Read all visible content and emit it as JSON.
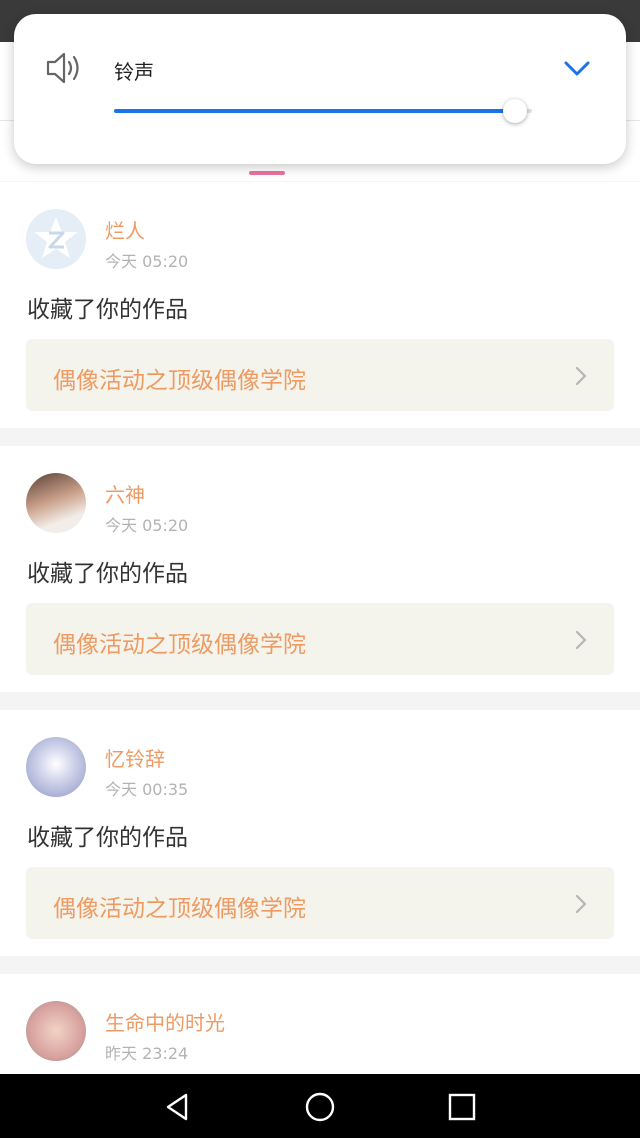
{
  "volume": {
    "label": "铃声",
    "level": 0.96,
    "icons": {
      "speaker": "speaker-icon",
      "expand": "chevron-down-icon"
    },
    "accent_color": "#1a73e8"
  },
  "notifications": [
    {
      "user": "烂人",
      "time": "今天 05:20",
      "action": "收藏了你的作品",
      "work": "偶像活动之顶级偶像学院"
    },
    {
      "user": "六神",
      "time": "今天 05:20",
      "action": "收藏了你的作品",
      "work": "偶像活动之顶级偶像学院"
    },
    {
      "user": "忆铃辞",
      "time": "今天 00:35",
      "action": "收藏了你的作品",
      "work": "偶像活动之顶级偶像学院"
    },
    {
      "user": "生命中的时光",
      "time": "昨天 23:24"
    }
  ],
  "colors": {
    "name_accent": "#ee9b63",
    "tab_indicator": "#e9739f",
    "link_background": "#f5f4ec"
  },
  "navbar": {
    "icons": [
      "back-triangle-icon",
      "home-circle-icon",
      "recents-square-icon"
    ]
  }
}
